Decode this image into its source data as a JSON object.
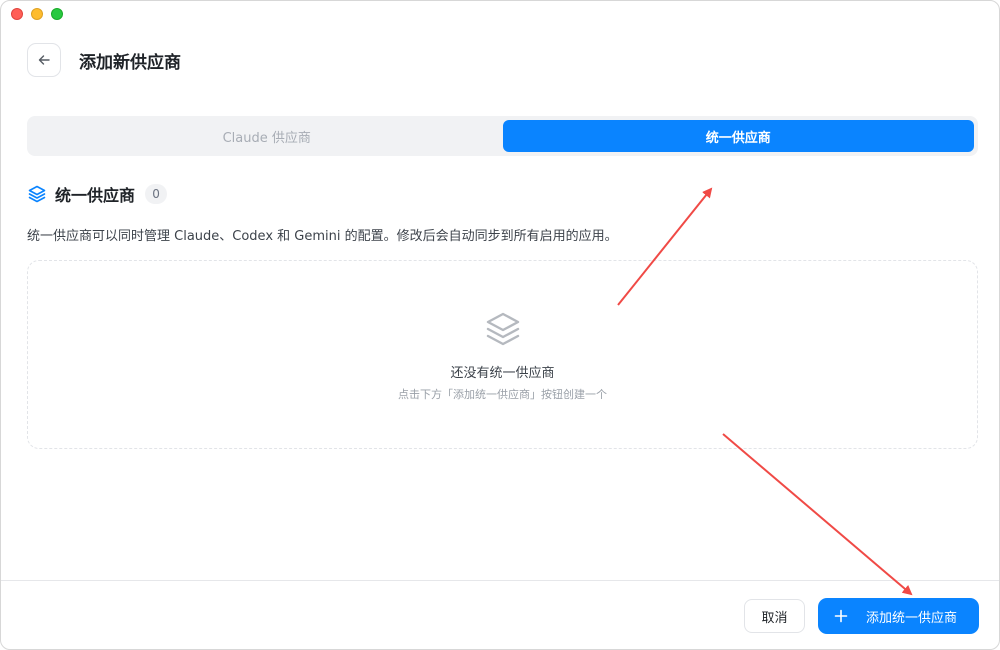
{
  "header": {
    "title": "添加新供应商",
    "back_icon": "arrow-left-icon"
  },
  "tabs": [
    {
      "label": "Claude 供应商",
      "active": false
    },
    {
      "label": "统一供应商",
      "active": true
    }
  ],
  "section": {
    "icon": "layers-icon",
    "title": "统一供应商",
    "count": "0",
    "description": "统一供应商可以同时管理 Claude、Codex 和 Gemini 的配置。修改后会自动同步到所有启用的应用。"
  },
  "empty_state": {
    "icon": "layers-icon",
    "title": "还没有统一供应商",
    "subtitle": "点击下方「添加统一供应商」按钮创建一个"
  },
  "footer": {
    "cancel_label": "取消",
    "add_label": "添加统一供应商",
    "add_icon": "plus-icon"
  },
  "colors": {
    "accent": "#0a84ff",
    "annotation_arrow": "#f04a46"
  }
}
